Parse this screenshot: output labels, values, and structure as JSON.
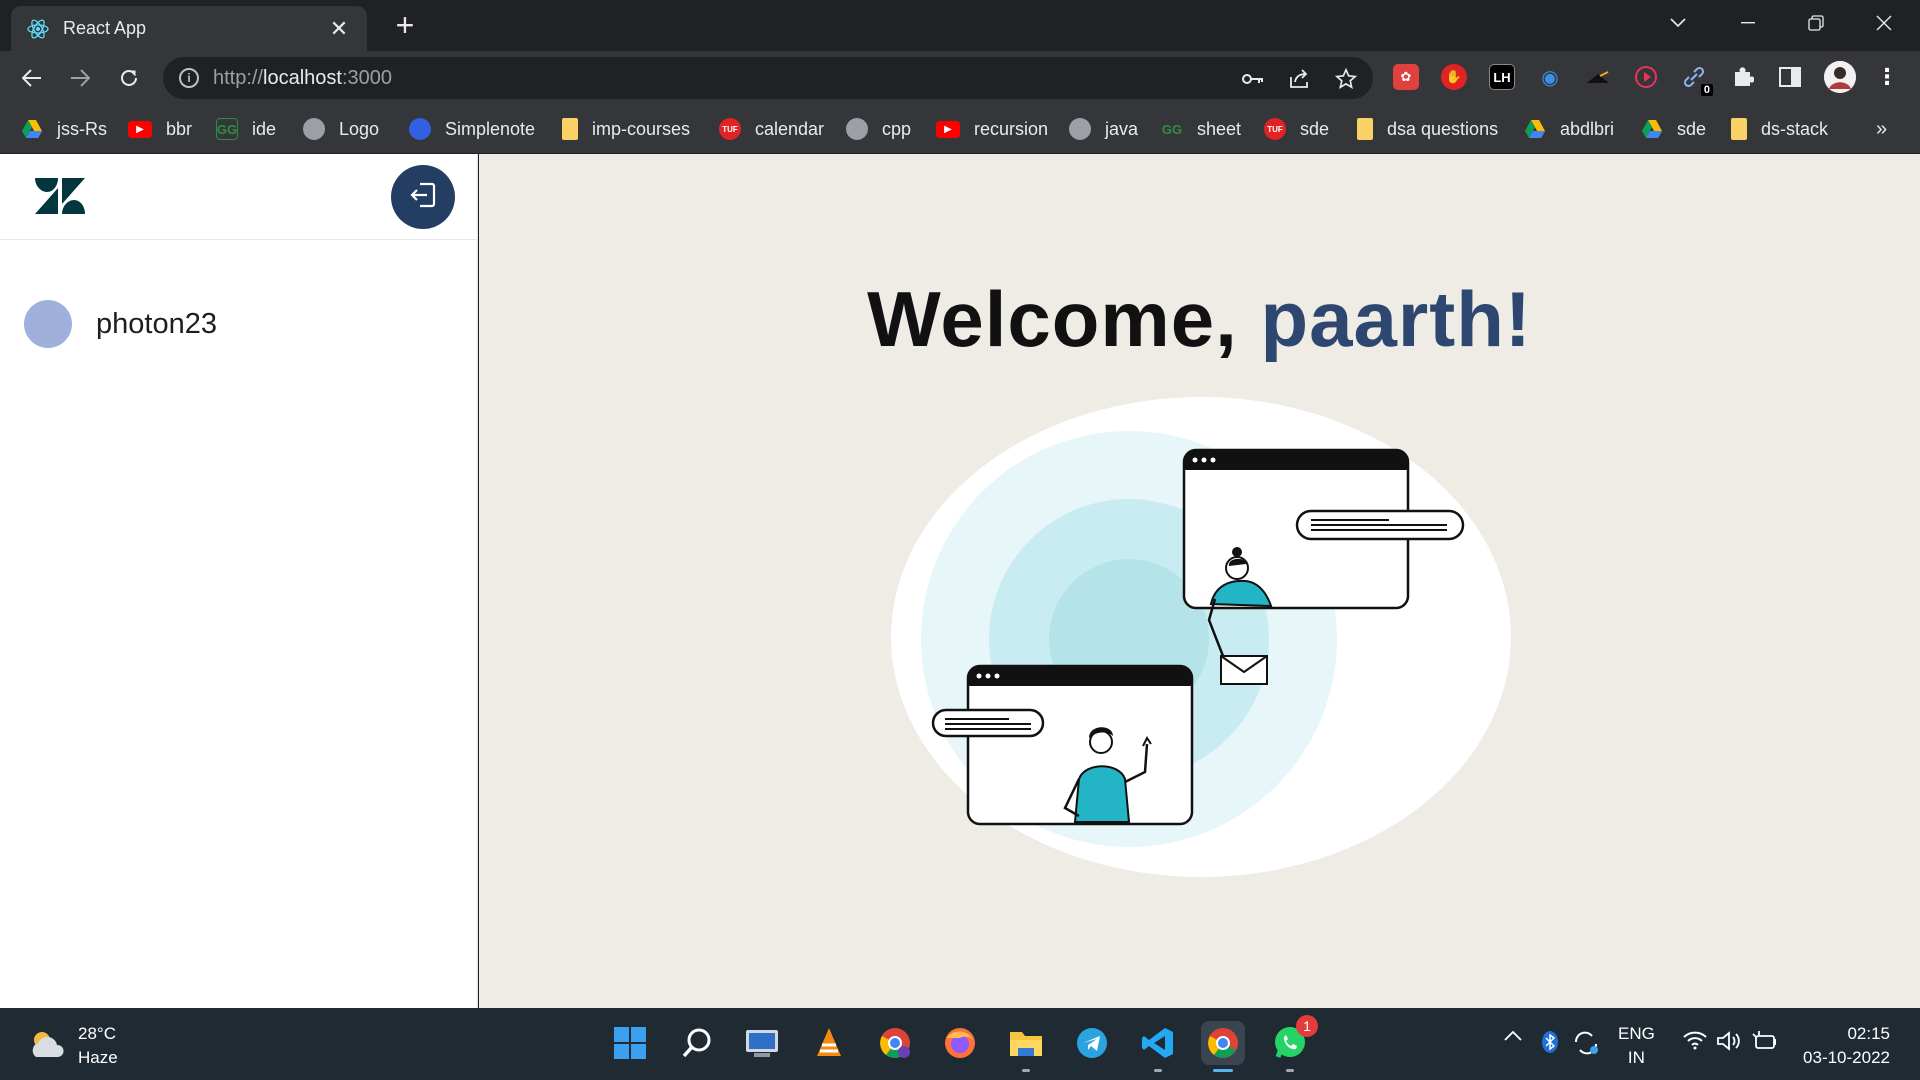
{
  "browser": {
    "tab": {
      "title": "React App",
      "favicon": "react-icon"
    },
    "new_tab_symbol": "+",
    "address": {
      "scheme": "http://",
      "host": "localhost",
      "port": ":3000"
    },
    "bookmarks": [
      {
        "label": "jss-Rs",
        "icon": "drive-icon"
      },
      {
        "label": "bbr",
        "icon": "youtube-icon"
      },
      {
        "label": "ide",
        "icon": "gfg-icon"
      },
      {
        "label": "Logo",
        "icon": "globe-icon"
      },
      {
        "label": "Simplenote",
        "icon": "simplenote-icon"
      },
      {
        "label": "imp-courses",
        "icon": "folder-icon"
      },
      {
        "label": "calendar",
        "icon": "tuf-icon"
      },
      {
        "label": "cpp",
        "icon": "globe-icon"
      },
      {
        "label": "recursion",
        "icon": "youtube-icon"
      },
      {
        "label": "java",
        "icon": "globe-icon"
      },
      {
        "label": "sheet",
        "icon": "gfg-icon"
      },
      {
        "label": "sde",
        "icon": "tuf-icon"
      },
      {
        "label": "dsa questions",
        "icon": "folder-icon"
      },
      {
        "label": "abdlbri",
        "icon": "drive-icon"
      },
      {
        "label": "sde",
        "icon": "drive-icon"
      },
      {
        "label": "ds-stack",
        "icon": "folder-icon"
      }
    ],
    "bookmarks_overflow": "»",
    "extension_badge": "0",
    "extensions": [
      "ext-red-icon",
      "ext-hand-icon",
      "ext-lh-icon",
      "ext-edge-icon",
      "ext-dark-icon",
      "ext-play-icon",
      "ext-link-icon",
      "puzzle-icon",
      "sidepanel-icon",
      "profile-avatar"
    ]
  },
  "app": {
    "logo": "zendesk-logo",
    "user": {
      "name": "photon23"
    },
    "welcome": {
      "prefix": "Welcome, ",
      "name": "paarth!"
    }
  },
  "taskbar": {
    "weather": {
      "temp": "28°C",
      "condition": "Haze"
    },
    "apps": [
      "start-icon",
      "search-icon",
      "remote-desktop-icon",
      "vlc-icon",
      "chrome-profile-icon",
      "firefox-icon",
      "file-explorer-icon",
      "telegram-icon",
      "vscode-icon",
      "chrome-icon",
      "whatsapp-icon"
    ],
    "whatsapp_badge": "1",
    "tray": {
      "lang_line1": "ENG",
      "lang_line2": "IN",
      "time": "02:15",
      "date": "03-10-2022"
    },
    "colors": {
      "accent": "#58b4f0",
      "badge": "#e43c3c"
    }
  },
  "colors": {
    "name_accent": "#2d4770",
    "logout_bg": "#233d63",
    "avatar": "#9fb0dd",
    "main_bg": "#efebe5"
  }
}
